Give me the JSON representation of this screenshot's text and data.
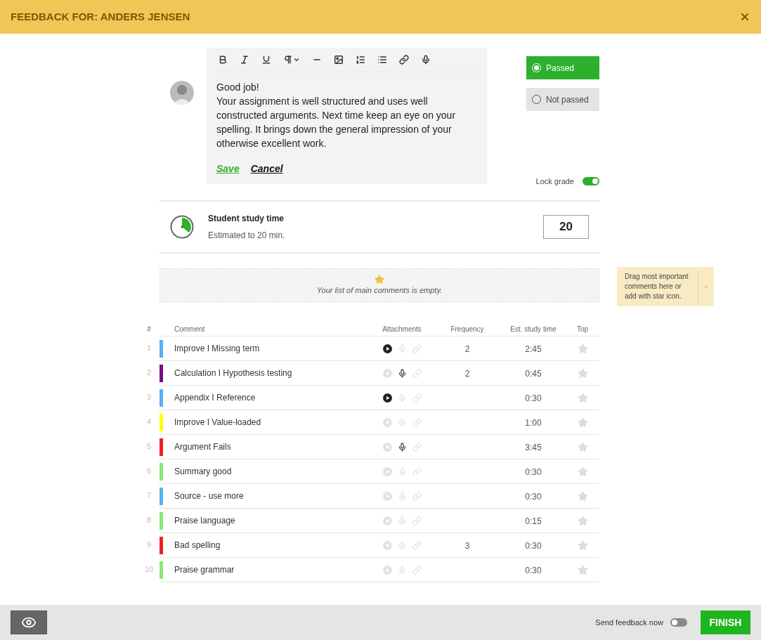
{
  "header": {
    "title": "FEEDBACK FOR: ANDERS JENSEN"
  },
  "editor": {
    "lines": [
      "Good job!",
      "Your assignment is well structured and uses well constructed arguments. Next time keep an eye on your spelling. It brings down the general impression of your otherwise excellent work."
    ],
    "save": "Save",
    "cancel": "Cancel"
  },
  "grade_options": [
    {
      "label": "Passed",
      "selected": true
    },
    {
      "label": "Not passed",
      "selected": false
    }
  ],
  "lock_grade": {
    "label": "Lock grade",
    "on": true
  },
  "study_time": {
    "title": "Student study time",
    "subtitle": "Estimated to 20 min.",
    "value": "20"
  },
  "main_comments": {
    "empty_text": "Your list of main comments is empty."
  },
  "tip": {
    "text": "Drag most important comments here or add with star icon."
  },
  "table": {
    "columns": [
      "#",
      "Comment",
      "Attachments",
      "Frequency",
      "Est. study time",
      "Top"
    ],
    "rows": [
      {
        "index": "1",
        "color": "#55b1f7",
        "comment": "Improve I Missing term",
        "video": true,
        "audio": false,
        "link": false,
        "frequency": "2",
        "time": "2:45",
        "starred": false
      },
      {
        "index": "2",
        "color": "#7a0b85",
        "comment": "Calculation I Hypothesis testing",
        "video": false,
        "audio": true,
        "link": false,
        "frequency": "2",
        "time": "0:45",
        "starred": false
      },
      {
        "index": "3",
        "color": "#55b1f7",
        "comment": "Appendix I Reference",
        "video": true,
        "audio": false,
        "link": false,
        "time": "0:30",
        "starred": false
      },
      {
        "index": "4",
        "color": "#ffff00",
        "comment": "Improve I Value-loaded",
        "video": false,
        "audio": false,
        "link": false,
        "time": "1:00",
        "starred": false
      },
      {
        "index": "5",
        "color": "#f02020",
        "comment": "Argument Fails",
        "video": false,
        "audio": true,
        "link": false,
        "time": "3:45",
        "starred": false
      },
      {
        "index": "6",
        "color": "#88e870",
        "comment": "Summary good",
        "video": false,
        "audio": false,
        "link": false,
        "time": "0:30",
        "starred": false
      },
      {
        "index": "7",
        "color": "#55b1f7",
        "comment": "Source - use more",
        "video": false,
        "audio": false,
        "link": false,
        "time": "0:30",
        "starred": false
      },
      {
        "index": "8",
        "color": "#88e870",
        "comment": "Praise language",
        "video": false,
        "audio": false,
        "link": false,
        "time": "0:15",
        "starred": false
      },
      {
        "index": "9",
        "color": "#f02020",
        "comment": "Bad spelling",
        "video": false,
        "audio": false,
        "link": false,
        "frequency": "3",
        "time": "0:30",
        "starred": false
      },
      {
        "index": "10",
        "color": "#88e870",
        "comment": "Praise grammar",
        "video": false,
        "audio": false,
        "link": false,
        "time": "0:30",
        "starred": false
      }
    ]
  },
  "footer": {
    "send_now": {
      "label": "Send feedback now",
      "on": false
    },
    "finish": "FINISH"
  }
}
